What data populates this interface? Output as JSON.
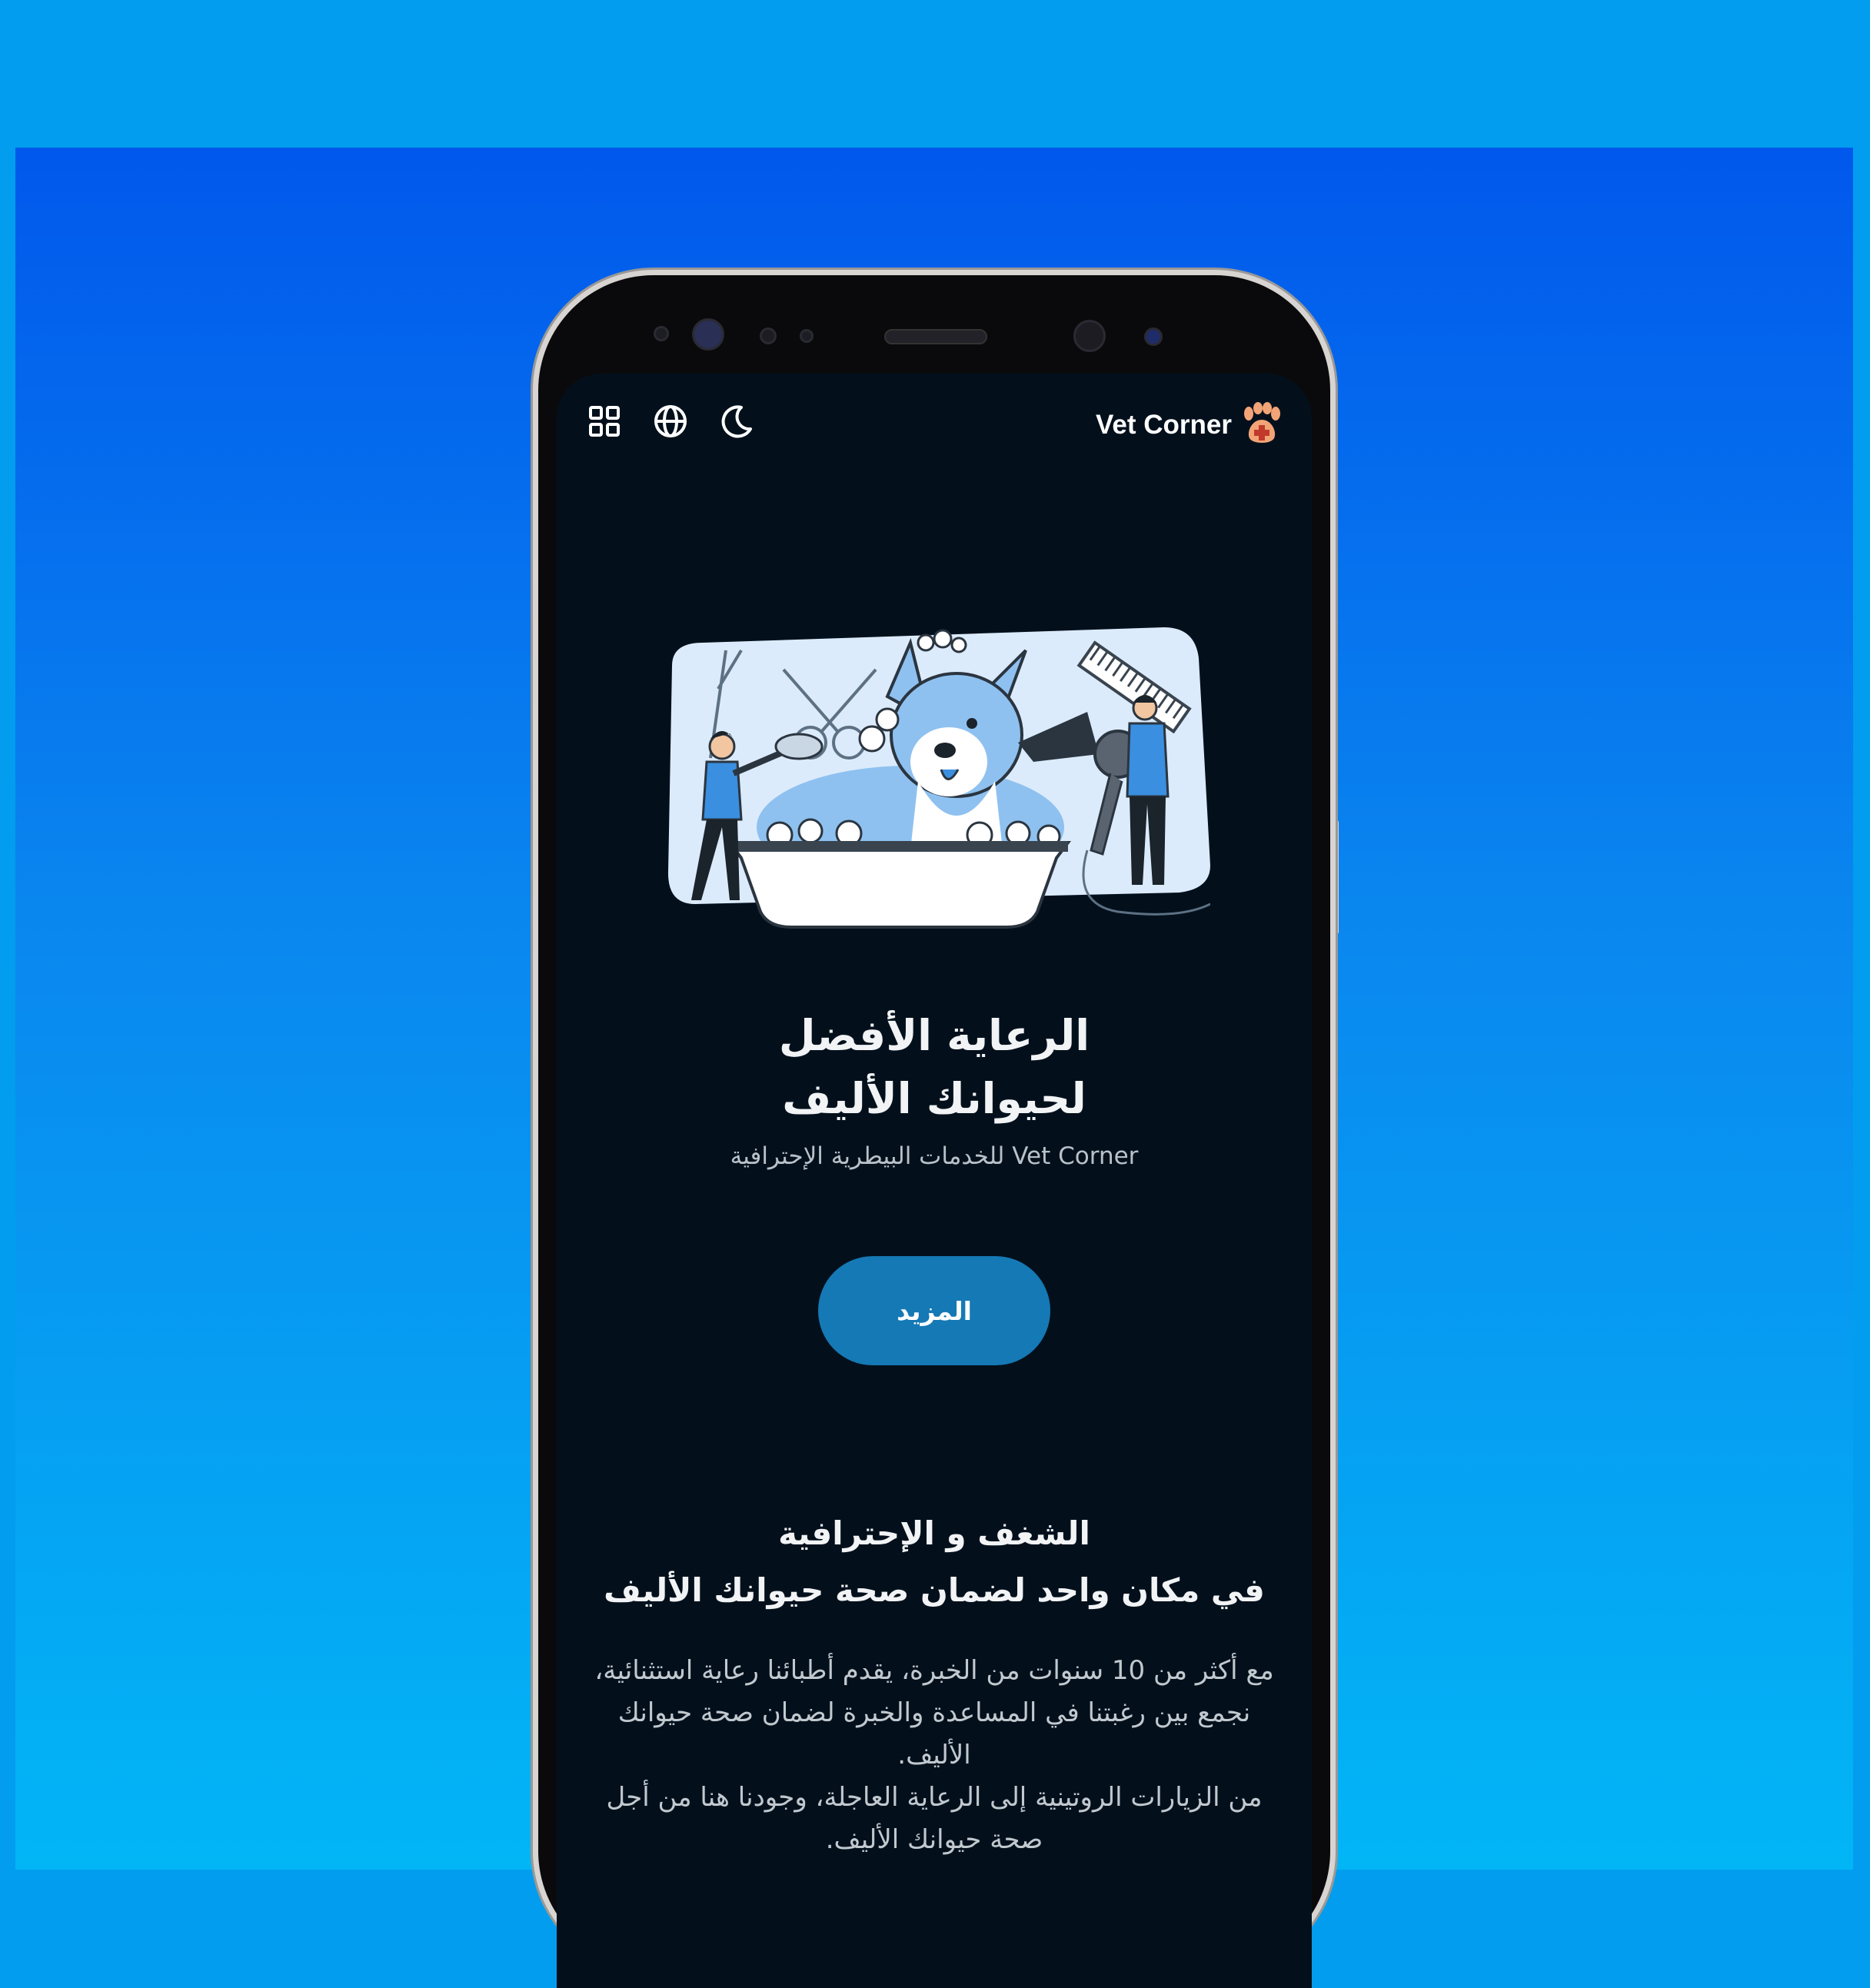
{
  "colors": {
    "page_background": "#029dee",
    "screen_background": "#03101c",
    "accent_button": "#1579b5",
    "brand_paw": "#f2a477",
    "illustration_blue": "#8ec1f0"
  },
  "header": {
    "brand_name": "Vet Corner",
    "brand_icon": "paw-cross-icon",
    "icons": [
      "grid-menu-icon",
      "globe-language-icon",
      "moon-dark-mode-icon"
    ]
  },
  "hero": {
    "illustration": "dog-grooming-illustration",
    "title_line1": "الرعاية الأفضل",
    "title_line2": "لحيوانك الأليف",
    "subtitle": "Vet Corner للخدمات البيطرية الإحترافية",
    "cta_label": "المزيد"
  },
  "about": {
    "title_line1": "الشغف و الإحترافية",
    "title_line2": "في مكان واحد لضمان صحة حيوانك الأليف",
    "paragraph1": "مع أكثر من 10 سنوات من الخبرة، يقدم أطبائنا رعاية استثنائية، نجمع بين رغبتنا في المساعدة والخبرة لضمان صحة حيوانك الأليف.",
    "paragraph2": "من الزيارات الروتينية إلى الرعاية العاجلة، وجودنا هنا من أجل صحة حيوانك الأليف."
  }
}
